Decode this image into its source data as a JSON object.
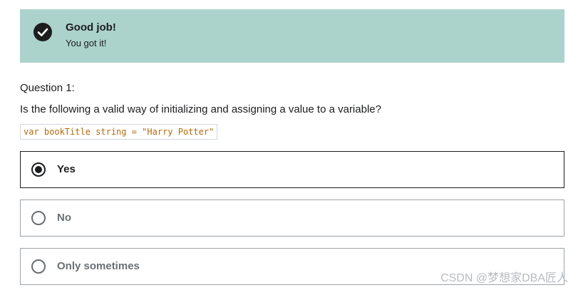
{
  "feedback": {
    "icon": "check-circle-icon",
    "title": "Good job!",
    "message": "You got it!",
    "background_color": "#acd2cc"
  },
  "question": {
    "label": "Question 1:",
    "prompt": "Is the following a valid way of initializing and assigning a value to a variable?",
    "code": "var bookTitle string = \"Harry Potter\""
  },
  "options": [
    {
      "label": "Yes",
      "selected": true
    },
    {
      "label": "No",
      "selected": false
    },
    {
      "label": "Only sometimes",
      "selected": false
    }
  ],
  "watermark": "CSDN @梦想家DBA匠人"
}
